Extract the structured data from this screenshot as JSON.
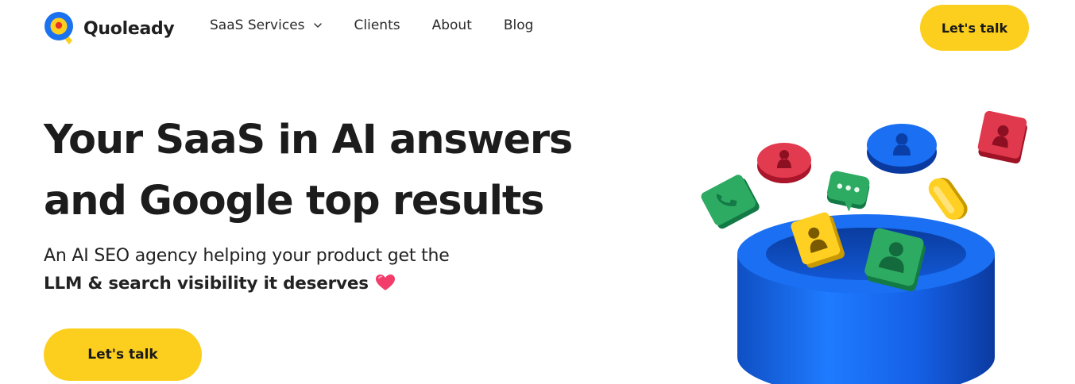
{
  "brand": {
    "name": "Quoleady",
    "accent_yellow": "#fccf1e",
    "accent_blue": "#1565e0",
    "logo_icon": "q-pin-logo-icon"
  },
  "nav": {
    "items": [
      {
        "label": "SaaS Services",
        "has_dropdown": true,
        "icon": "chevron-down-icon"
      },
      {
        "label": "Clients",
        "has_dropdown": false
      },
      {
        "label": "About",
        "has_dropdown": false
      },
      {
        "label": "Blog",
        "has_dropdown": false
      }
    ],
    "cta_label": "Let's talk"
  },
  "hero": {
    "title_line1": "Your SaaS in AI answers",
    "title_line2": "and Google top results",
    "subtitle_line1": "An AI SEO agency helping your product get the",
    "subtitle_line2": "LLM & search visibility it deserves",
    "emoji_icon": "heart-icon",
    "cta_label": "Let's talk"
  },
  "illustration": {
    "icons": [
      "blue-cylinder-funnel-icon",
      "user-token-icon",
      "chat-bubble-icon",
      "pill-token-icon"
    ]
  }
}
